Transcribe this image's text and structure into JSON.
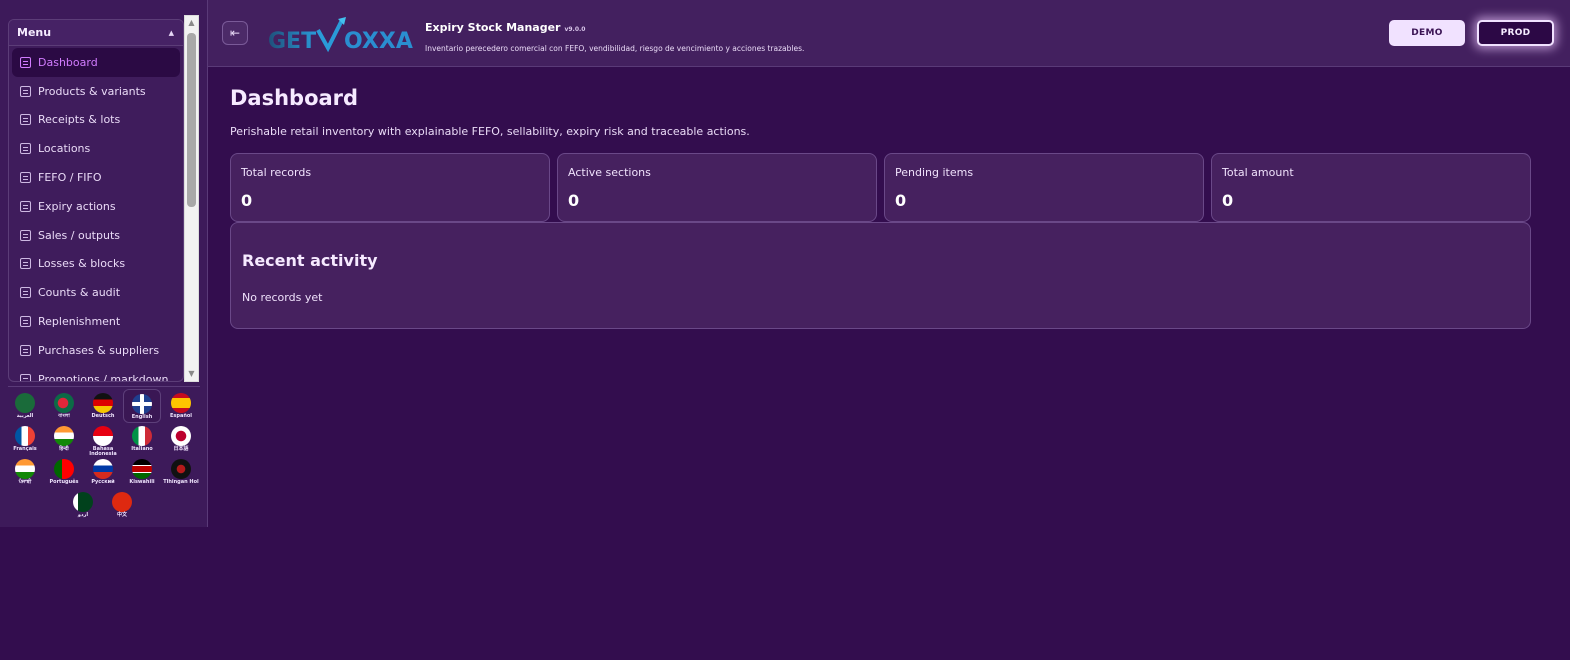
{
  "sidebar": {
    "menu_title": "Menu",
    "items": [
      {
        "label": "Dashboard",
        "active": true
      },
      {
        "label": "Products & variants"
      },
      {
        "label": "Receipts & lots"
      },
      {
        "label": "Locations"
      },
      {
        "label": "FEFO / FIFO"
      },
      {
        "label": "Expiry actions"
      },
      {
        "label": "Sales / outputs"
      },
      {
        "label": "Losses & blocks"
      },
      {
        "label": "Counts & audit"
      },
      {
        "label": "Replenishment"
      },
      {
        "label": "Purchases & suppliers"
      },
      {
        "label": "Promotions / markdown"
      }
    ],
    "languages": [
      {
        "label": "العربية",
        "icon": "flag-saudi-arabia-icon"
      },
      {
        "label": "বাংলা",
        "icon": "flag-bangladesh-icon"
      },
      {
        "label": "Deutsch",
        "icon": "flag-germany-icon"
      },
      {
        "label": "English",
        "icon": "flag-uk-icon",
        "selected": true
      },
      {
        "label": "Español",
        "icon": "flag-spain-icon"
      },
      {
        "label": "Français",
        "icon": "flag-france-icon"
      },
      {
        "label": "हिन्दी",
        "icon": "flag-india-icon"
      },
      {
        "label": "Bahasa Indonesia",
        "icon": "flag-indonesia-icon"
      },
      {
        "label": "Italiano",
        "icon": "flag-italy-icon"
      },
      {
        "label": "日本語",
        "icon": "flag-japan-icon"
      },
      {
        "label": "ਪੰਜਾਬੀ",
        "icon": "flag-india-punjabi-icon"
      },
      {
        "label": "Português",
        "icon": "flag-portugal-icon"
      },
      {
        "label": "Русский",
        "icon": "flag-russia-icon"
      },
      {
        "label": "Kiswahili",
        "icon": "flag-kenya-icon"
      },
      {
        "label": "Tlhingan Hol",
        "icon": "flag-klingon-icon"
      },
      {
        "label": "اردو",
        "icon": "flag-pakistan-icon"
      },
      {
        "label": "中文",
        "icon": "flag-china-icon"
      }
    ]
  },
  "header": {
    "logo_text": "GETVOXXA",
    "title": "Expiry Stock Manager",
    "version": "v9.0.0",
    "subtitle": "Inventario perecedero comercial con FEFO, vendibilidad, riesgo de vencimiento y acciones trazables.",
    "demo_label": "DEMO",
    "prod_label": "PROD"
  },
  "main": {
    "title": "Dashboard",
    "subtitle": "Perishable retail inventory with explainable FEFO, sellability, expiry risk and traceable actions.",
    "stats": [
      {
        "label": "Total records",
        "value": "0"
      },
      {
        "label": "Active sections",
        "value": "0"
      },
      {
        "label": "Pending items",
        "value": "0"
      },
      {
        "label": "Total amount",
        "value": "0"
      }
    ],
    "activity": {
      "title": "Recent activity",
      "empty_text": "No records yet"
    }
  },
  "colors": {
    "background": "#330d4e",
    "panel": "#46215f",
    "accent": "#d27cff",
    "active_item_bg": "#2b0a44"
  }
}
